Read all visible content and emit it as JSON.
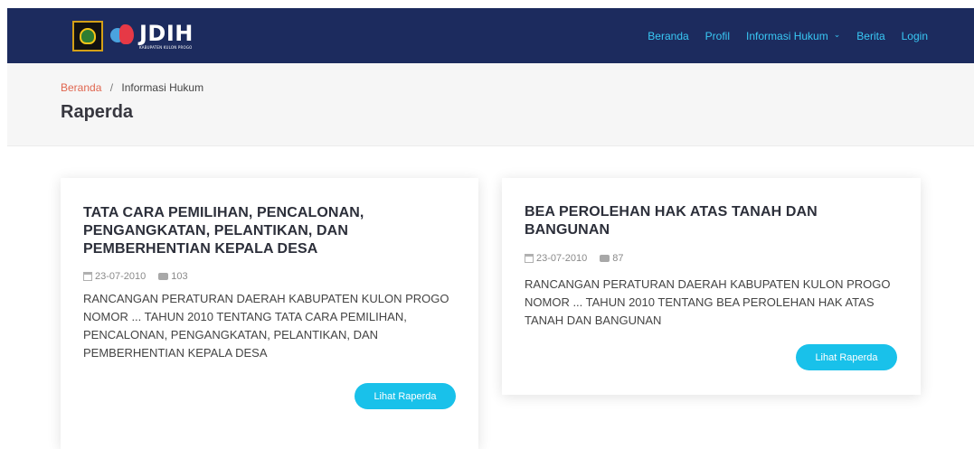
{
  "brand": {
    "title": "JDIH",
    "subtitle": "KABUPATEN KULON PROGO"
  },
  "nav": {
    "items": [
      {
        "label": "Beranda"
      },
      {
        "label": "Profil"
      },
      {
        "label": "Informasi Hukum"
      },
      {
        "label": "Berita"
      },
      {
        "label": "Login"
      }
    ]
  },
  "breadcrumb": {
    "home": "Beranda",
    "separator": "/",
    "current": "Informasi Hukum"
  },
  "page": {
    "title": "Raperda"
  },
  "cards": [
    {
      "title": "TATA CARA PEMILIHAN, PENCALONAN, PENGANGKATAN, PELANTIKAN, DAN PEMBERHENTIAN KEPALA DESA",
      "date": "23-07-2010",
      "views": "103",
      "description": "RANCANGAN PERATURAN DAERAH KABUPATEN KULON PROGO NOMOR ... TAHUN 2010 TENTANG TATA CARA PEMILIHAN, PENCALONAN, PENGANGKATAN, PELANTIKAN, DAN PEMBERHENTIAN KEPALA DESA",
      "button": "Lihat Raperda"
    },
    {
      "title": "BEA PEROLEHAN HAK ATAS TANAH DAN BANGUNAN",
      "date": "23-07-2010",
      "views": "87",
      "description": "RANCANGAN PERATURAN DAERAH KABUPATEN KULON PROGO NOMOR ... TAHUN 2010 TENTANG BEA PEROLEHAN HAK ATAS TANAH DAN BANGUNAN",
      "button": "Lihat Raperda"
    }
  ],
  "colors": {
    "navbar": "#1c2b5e",
    "nav_link": "#39c8f5",
    "breadcrumb_link": "#e0664f",
    "button": "#19c1ea"
  },
  "icons": {
    "calendar": "calendar-icon",
    "comment": "comment-icon",
    "dropdown": "chevron-down-icon"
  }
}
